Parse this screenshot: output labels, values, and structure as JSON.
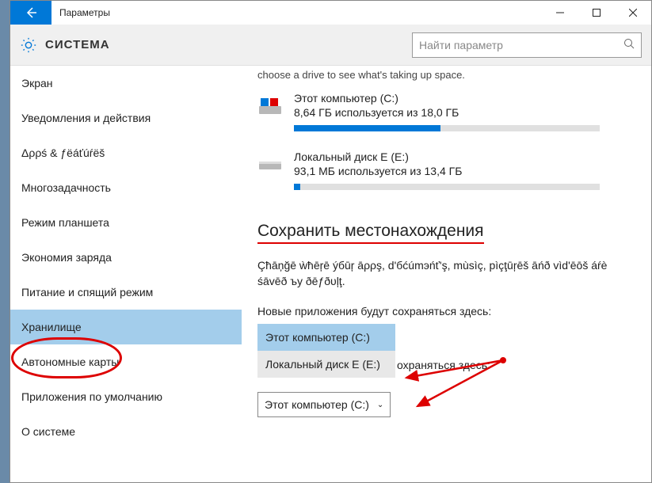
{
  "titlebar": {
    "title": "Параметры"
  },
  "header": {
    "title": "СИСТЕМА",
    "search_placeholder": "Найти параметр"
  },
  "sidebar": {
    "items": [
      {
        "label": "Экран"
      },
      {
        "label": "Уведомления и действия"
      },
      {
        "label": "Δρρś & ƒëáťúŕëš"
      },
      {
        "label": "Многозадачность"
      },
      {
        "label": "Режим планшета"
      },
      {
        "label": "Экономия заряда"
      },
      {
        "label": "Питание и спящий режим"
      },
      {
        "label": "Хранилище",
        "selected": true
      },
      {
        "label": "Автономные карты"
      },
      {
        "label": "Приложения по умолчанию"
      },
      {
        "label": "О системе"
      }
    ]
  },
  "content": {
    "clipped_hint": "choose a drive to see what's taking up space.",
    "drives": [
      {
        "name": "Этот компьютер (C:)",
        "stats": "8,64 ГБ используется из 18,0 ГБ",
        "fill_pct": 48
      },
      {
        "name": "Локальный диск E (E:)",
        "stats": "93,1 МБ используется из 13,4 ГБ",
        "fill_pct": 2
      }
    ],
    "section_title": "Сохранить местонахождения",
    "section_desc": "Çħāņğē ẁħēŗē ýбūŗ āρρş, d'бćúmэńť'ş, mùsìç, pìçţūŗēš āńð vìd'ēōš áŕè śāvēð ъу ðēƒðυļţ.",
    "field1_label": "Новые приложения будут сохраняться здесь:",
    "dropdown": {
      "options": [
        "Этот компьютер (C:)",
        "Локальный диск E (E:)"
      ],
      "selected_index": 0
    },
    "field2_trailing": "охраняться здесь:",
    "combo_value": "Этот компьютер (C:)"
  }
}
